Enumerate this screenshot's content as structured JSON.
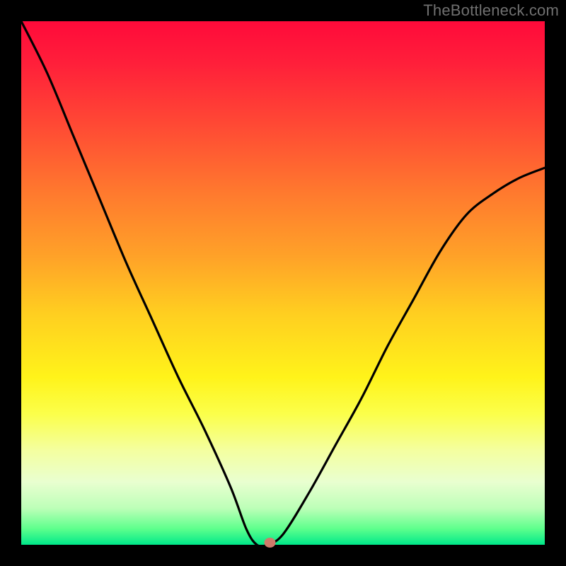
{
  "watermark": "TheBottleneck.com",
  "chart_data": {
    "type": "line",
    "title": "",
    "xlabel": "",
    "ylabel": "",
    "xlim": [
      0,
      1
    ],
    "ylim": [
      0,
      1
    ],
    "x": [
      0.0,
      0.05,
      0.1,
      0.15,
      0.2,
      0.25,
      0.3,
      0.35,
      0.4,
      0.43,
      0.45,
      0.47,
      0.5,
      0.55,
      0.6,
      0.65,
      0.7,
      0.75,
      0.8,
      0.85,
      0.9,
      0.95,
      1.0
    ],
    "values": [
      1.0,
      0.9,
      0.78,
      0.66,
      0.54,
      0.43,
      0.32,
      0.22,
      0.11,
      0.03,
      0.0,
      0.0,
      0.02,
      0.1,
      0.19,
      0.28,
      0.38,
      0.47,
      0.56,
      0.63,
      0.67,
      0.7,
      0.72
    ],
    "marker": {
      "x": 0.475,
      "y": 0.0
    },
    "gradient_colormap": "red-yellow-green (vertical, low=green at bottom)"
  }
}
